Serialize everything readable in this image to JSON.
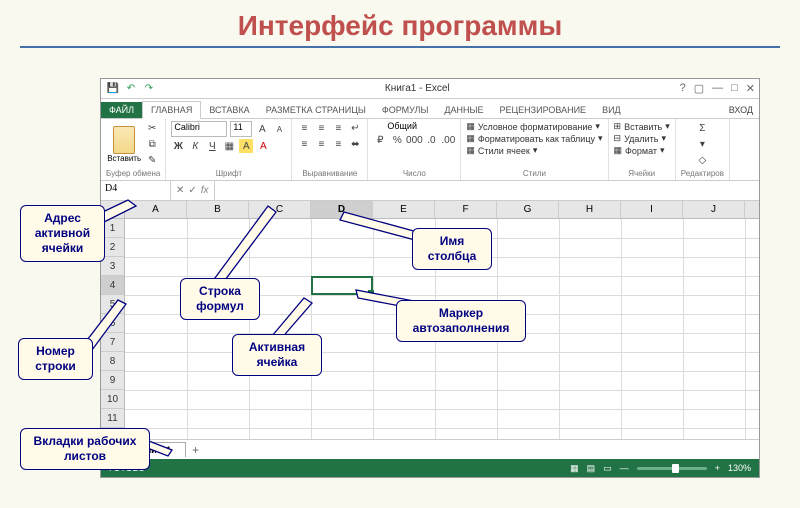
{
  "page": {
    "title": "Интерфейс программы"
  },
  "window": {
    "title": "Книга1 - Excel",
    "signin": "Вход"
  },
  "qat": {
    "save": "💾",
    "undo": "↶",
    "redo": "↷"
  },
  "tabs": {
    "file": "ФАЙЛ",
    "items": [
      "ГЛАВНАЯ",
      "ВСТАВКА",
      "РАЗМЕТКА СТРАНИЦЫ",
      "ФОРМУЛЫ",
      "ДАННЫЕ",
      "РЕЦЕНЗИРОВАНИЕ",
      "ВИД"
    ],
    "activeIndex": 0
  },
  "ribbon": {
    "clipboard": {
      "paste": "Вставить",
      "label": "Буфер обмена"
    },
    "font": {
      "face": "Calibri",
      "size": "11",
      "label": "Шрифт"
    },
    "align": {
      "label": "Выравнивание"
    },
    "number": {
      "format": "Общий",
      "label": "Число"
    },
    "styles": {
      "cond": "Условное форматирование",
      "table": "Форматировать как таблицу",
      "cell": "Стили ячеек",
      "label": "Стили"
    },
    "cells": {
      "insert": "Вставить",
      "delete": "Удалить",
      "format": "Формат",
      "label": "Ячейки"
    },
    "edit": {
      "label": "Редактиров"
    }
  },
  "namebox": {
    "cell": "D4",
    "fx": "fx"
  },
  "grid": {
    "cols": [
      "A",
      "B",
      "C",
      "D",
      "E",
      "F",
      "G",
      "H",
      "I",
      "J"
    ],
    "rows": [
      "1",
      "2",
      "3",
      "4",
      "5",
      "6",
      "7",
      "8",
      "9",
      "10",
      "11"
    ],
    "activeCol": "D",
    "activeRow": "4"
  },
  "sheets": {
    "tab": "Лист1",
    "add": "+"
  },
  "status": {
    "ready": "ГОТОВО",
    "zoom": "130%"
  },
  "callouts": {
    "addr": "Адрес активной ячейки",
    "row": "Номер строки",
    "tabs": "Вкладки рабочих листов",
    "formula": "Строка формул",
    "active": "Активная ячейка",
    "colname": "Имя столбца",
    "fill": "Маркер автозаполнения"
  }
}
